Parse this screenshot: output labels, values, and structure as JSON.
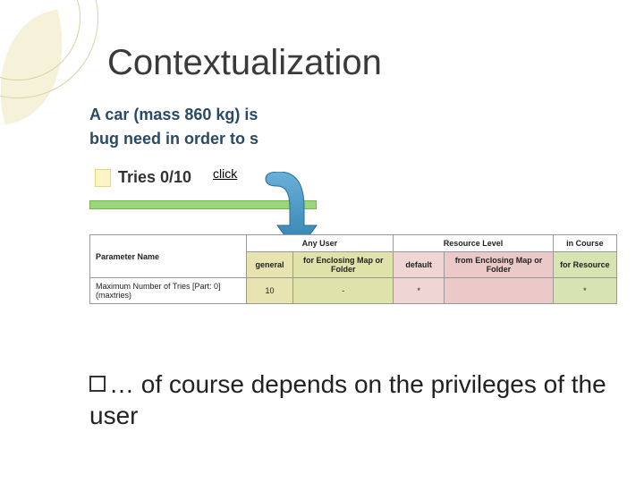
{
  "title": "Contextualization",
  "problem": {
    "line1": "A car (mass 860 kg) is",
    "line2": "bug need in order to s"
  },
  "tries_label": "Tries 0/10",
  "click_label": "click",
  "table": {
    "any_user": "Any User",
    "param_name_hdr": "Parameter Name",
    "in_course": "in Course",
    "enclosing": "for Enclosing Map or Folder",
    "general": "general",
    "default": "default",
    "from_enclosing": "from Enclosing Map or Folder",
    "resource_level": "Resource Level",
    "for_resource": "for Resource",
    "row": {
      "name": "Maximum Number of Tries [Part: 0] (maxtries)",
      "general": "10",
      "map": "-",
      "default": "*",
      "frommap": "",
      "forres": "*"
    }
  },
  "bullet_text": "… of course depends on the privileges of the user",
  "chart_data": {
    "type": "table",
    "title": "Parameter override table (partial)",
    "columns": [
      "Parameter Name",
      "general",
      "for Enclosing Map or Folder",
      "default",
      "from Enclosing Map or Folder",
      "for Resource"
    ],
    "column_groups": {
      "Any User": [
        "in Course",
        "for Enclosing Map or Folder"
      ],
      "Resource Level": [
        "default",
        "from Enclosing Map or Folder",
        "in Course / for Resource"
      ]
    },
    "rows": [
      {
        "Parameter Name": "Maximum Number of Tries [Part: 0] (maxtries)",
        "general": 10,
        "for Enclosing Map or Folder": "-",
        "default": "*",
        "from Enclosing Map or Folder": "",
        "for Resource": "*"
      }
    ]
  }
}
